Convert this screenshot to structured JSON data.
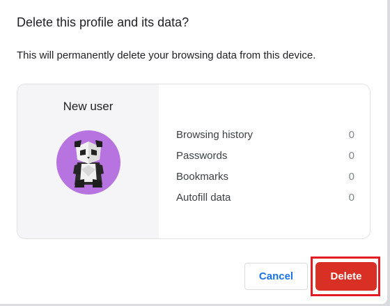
{
  "dialog": {
    "title": "Delete this profile and its data?",
    "description": "This will permanently delete your browsing data from this device."
  },
  "profile": {
    "name": "New user",
    "avatar_icon": "panda-avatar-icon",
    "avatar_color": "#b773e0"
  },
  "stats": [
    {
      "label": "Browsing history",
      "value": "0"
    },
    {
      "label": "Passwords",
      "value": "0"
    },
    {
      "label": "Bookmarks",
      "value": "0"
    },
    {
      "label": "Autofill data",
      "value": "0"
    }
  ],
  "buttons": {
    "cancel_label": "Cancel",
    "delete_label": "Delete"
  },
  "colors": {
    "accent": "#1a73e8",
    "danger": "#d93025",
    "highlight_outline": "#e31b23"
  }
}
